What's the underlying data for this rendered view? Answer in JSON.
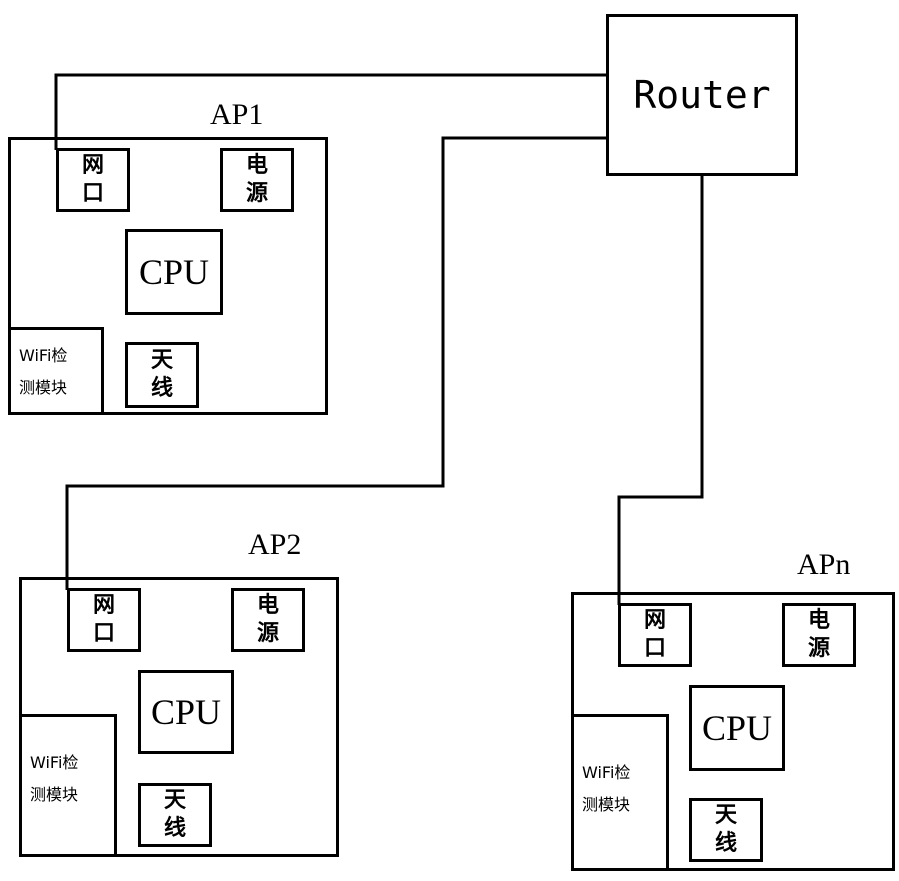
{
  "router": {
    "label": "Router"
  },
  "access_points": [
    {
      "id": "ap1",
      "label": "AP1",
      "components": {
        "port": [
          "网",
          "口"
        ],
        "power": [
          "电",
          "源"
        ],
        "cpu": "CPU",
        "antenna": [
          "天",
          "线"
        ],
        "wifi_module": [
          "WiFi检",
          "测模块"
        ]
      }
    },
    {
      "id": "ap2",
      "label": "AP2",
      "components": {
        "port": [
          "网",
          "口"
        ],
        "power": [
          "电",
          "源"
        ],
        "cpu": "CPU",
        "antenna": [
          "天",
          "线"
        ],
        "wifi_module": [
          "WiFi检",
          "测模块"
        ]
      }
    },
    {
      "id": "apn",
      "label": "APn",
      "components": {
        "port": [
          "网",
          "口"
        ],
        "power": [
          "电",
          "源"
        ],
        "cpu": "CPU",
        "antenna": [
          "天",
          "线"
        ],
        "wifi_module": [
          "WiFi检",
          "测模块"
        ]
      }
    }
  ],
  "connections": [
    {
      "from": "router",
      "to": "ap1.port"
    },
    {
      "from": "router",
      "to": "ap2.port"
    },
    {
      "from": "router",
      "to": "apn.port"
    }
  ],
  "colors": {
    "stroke": "#000000",
    "background": "#ffffff"
  }
}
